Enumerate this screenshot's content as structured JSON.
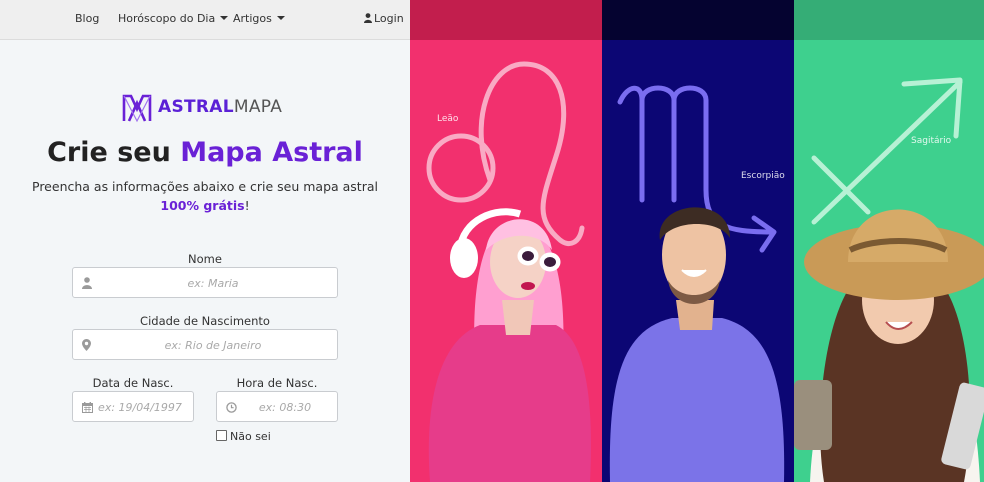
{
  "nav": {
    "blog": "Blog",
    "horoscope": "Horóscopo do Dia",
    "articles": "Artigos",
    "login": "Login"
  },
  "logo": {
    "astral": "ASTRAL",
    "mapa": "MAPA"
  },
  "hero": {
    "title_prefix": "Crie seu",
    "title_accent": "Mapa Astral",
    "subtitle": "Preencha as informações abaixo e crie seu mapa astral",
    "free_text": "100% grátis",
    "free_suffix": "!"
  },
  "form": {
    "name_label": "Nome",
    "name_placeholder": "ex: Maria",
    "city_label": "Cidade de Nascimento",
    "city_placeholder": "ex: Rio de Janeiro",
    "date_label": "Data de Nasc.",
    "date_placeholder": "ex: 19/04/1997",
    "time_label": "Hora de Nasc.",
    "time_placeholder": "ex: 08:30",
    "unknown_label": "Não sei"
  },
  "signs": [
    {
      "name": "Leão",
      "color": "#f2306e",
      "band": "#c21e4d"
    },
    {
      "name": "Escorpião",
      "color": "#0c0674",
      "band": "#050330"
    },
    {
      "name": "Sagitário",
      "color": "#3ed08e",
      "band": "#35ad76"
    }
  ],
  "colors": {
    "accent": "#6a21d6",
    "panel_bg": "#f3f6f8",
    "nav_bg": "#efefef"
  }
}
